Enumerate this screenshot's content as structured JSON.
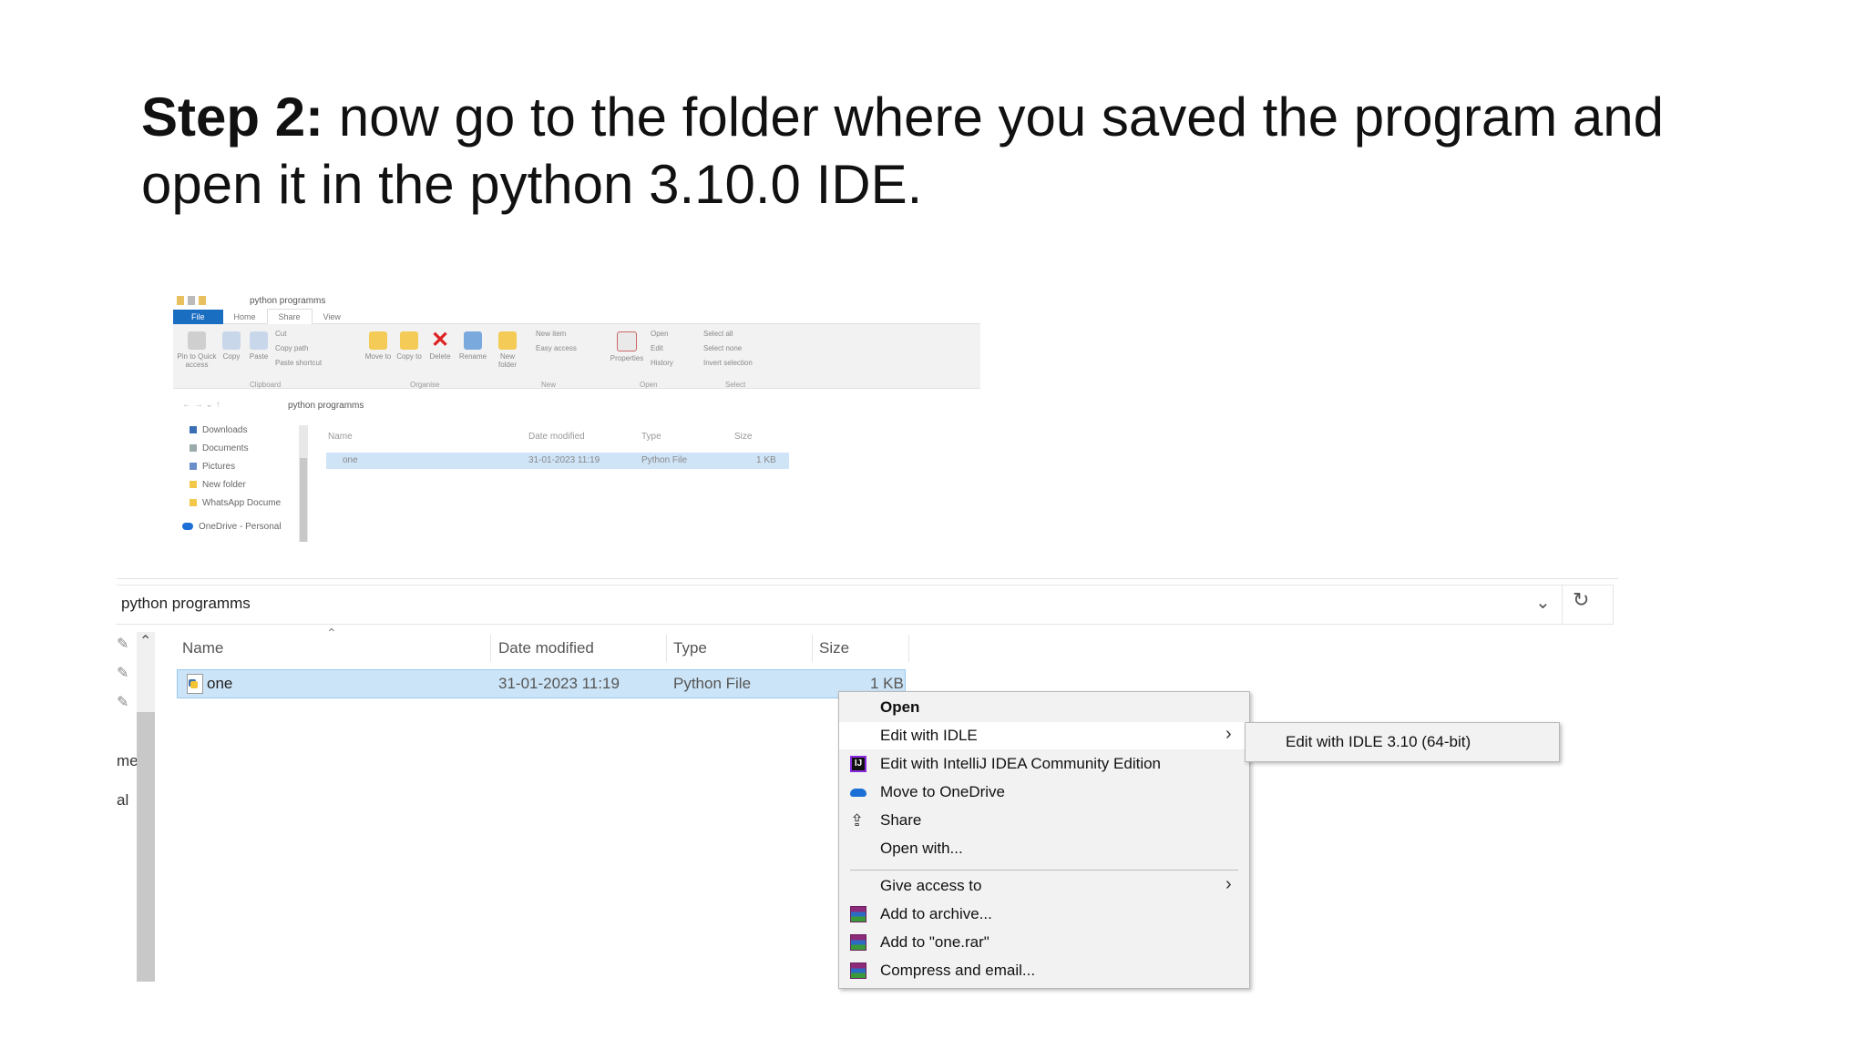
{
  "slide": {
    "heading_bold": "Step 2:",
    "heading_text": " now go to the folder where you saved the program and open it in the python 3.10.0 IDE."
  },
  "mini_explorer": {
    "window_title": "python programms",
    "ribbon_tabs": [
      "File",
      "Home",
      "Share",
      "View"
    ],
    "ribbon_buttons": {
      "pin": "Pin to Quick access",
      "copy": "Copy",
      "paste": "Paste",
      "cut": "Cut",
      "copy_path": "Copy path",
      "paste_shortcut": "Paste shortcut",
      "move_to": "Move to",
      "copy_to": "Copy to",
      "delete": "Delete",
      "rename": "Rename",
      "new_folder": "New folder",
      "new_item": "New item",
      "easy_access": "Easy access",
      "properties": "Properties",
      "open": "Open",
      "edit": "Edit",
      "history": "History",
      "select_all": "Select all",
      "select_none": "Select none",
      "invert_selection": "Invert selection"
    },
    "groups": [
      "Clipboard",
      "Organise",
      "New",
      "Open",
      "Select"
    ],
    "address_path": "python programms",
    "nav_items": [
      "Downloads",
      "Documents",
      "Pictures",
      "New folder",
      "WhatsApp Docume",
      "OneDrive - Personal"
    ],
    "columns": [
      "Name",
      "Date modified",
      "Type",
      "Size"
    ],
    "file": {
      "name": "one",
      "date": "31-01-2023 11:19",
      "type": "Python File",
      "size": "1 KB"
    }
  },
  "explorer": {
    "address_path": "python programms",
    "nav_clipped": [
      "me",
      "al"
    ],
    "columns": [
      "Name",
      "Date modified",
      "Type",
      "Size"
    ],
    "file": {
      "name": "one",
      "date": "31-01-2023 11:19",
      "type": "Python File",
      "size": "1 KB"
    }
  },
  "context_menu": {
    "open": "Open",
    "edit_idle": "Edit with IDLE",
    "edit_intellij": "Edit with IntelliJ IDEA Community Edition",
    "move_onedrive": "Move to OneDrive",
    "share": "Share",
    "open_with": "Open with...",
    "give_access": "Give access to",
    "add_archive": "Add to archive...",
    "add_rar": "Add to \"one.rar\"",
    "compress_email": "Compress and email..."
  },
  "submenu": {
    "edit_idle_310": "Edit with IDLE 3.10 (64-bit)"
  },
  "icons": {
    "intellij": "intellij-icon",
    "onedrive": "onedrive-icon",
    "share": "share-icon",
    "winrar": "winrar-icon",
    "python_file": "python-file-icon"
  },
  "colors": {
    "selection": "#cce4f7",
    "ribbon_file_tab": "#1a6ec2",
    "menu_bg": "#f2f2f2"
  }
}
